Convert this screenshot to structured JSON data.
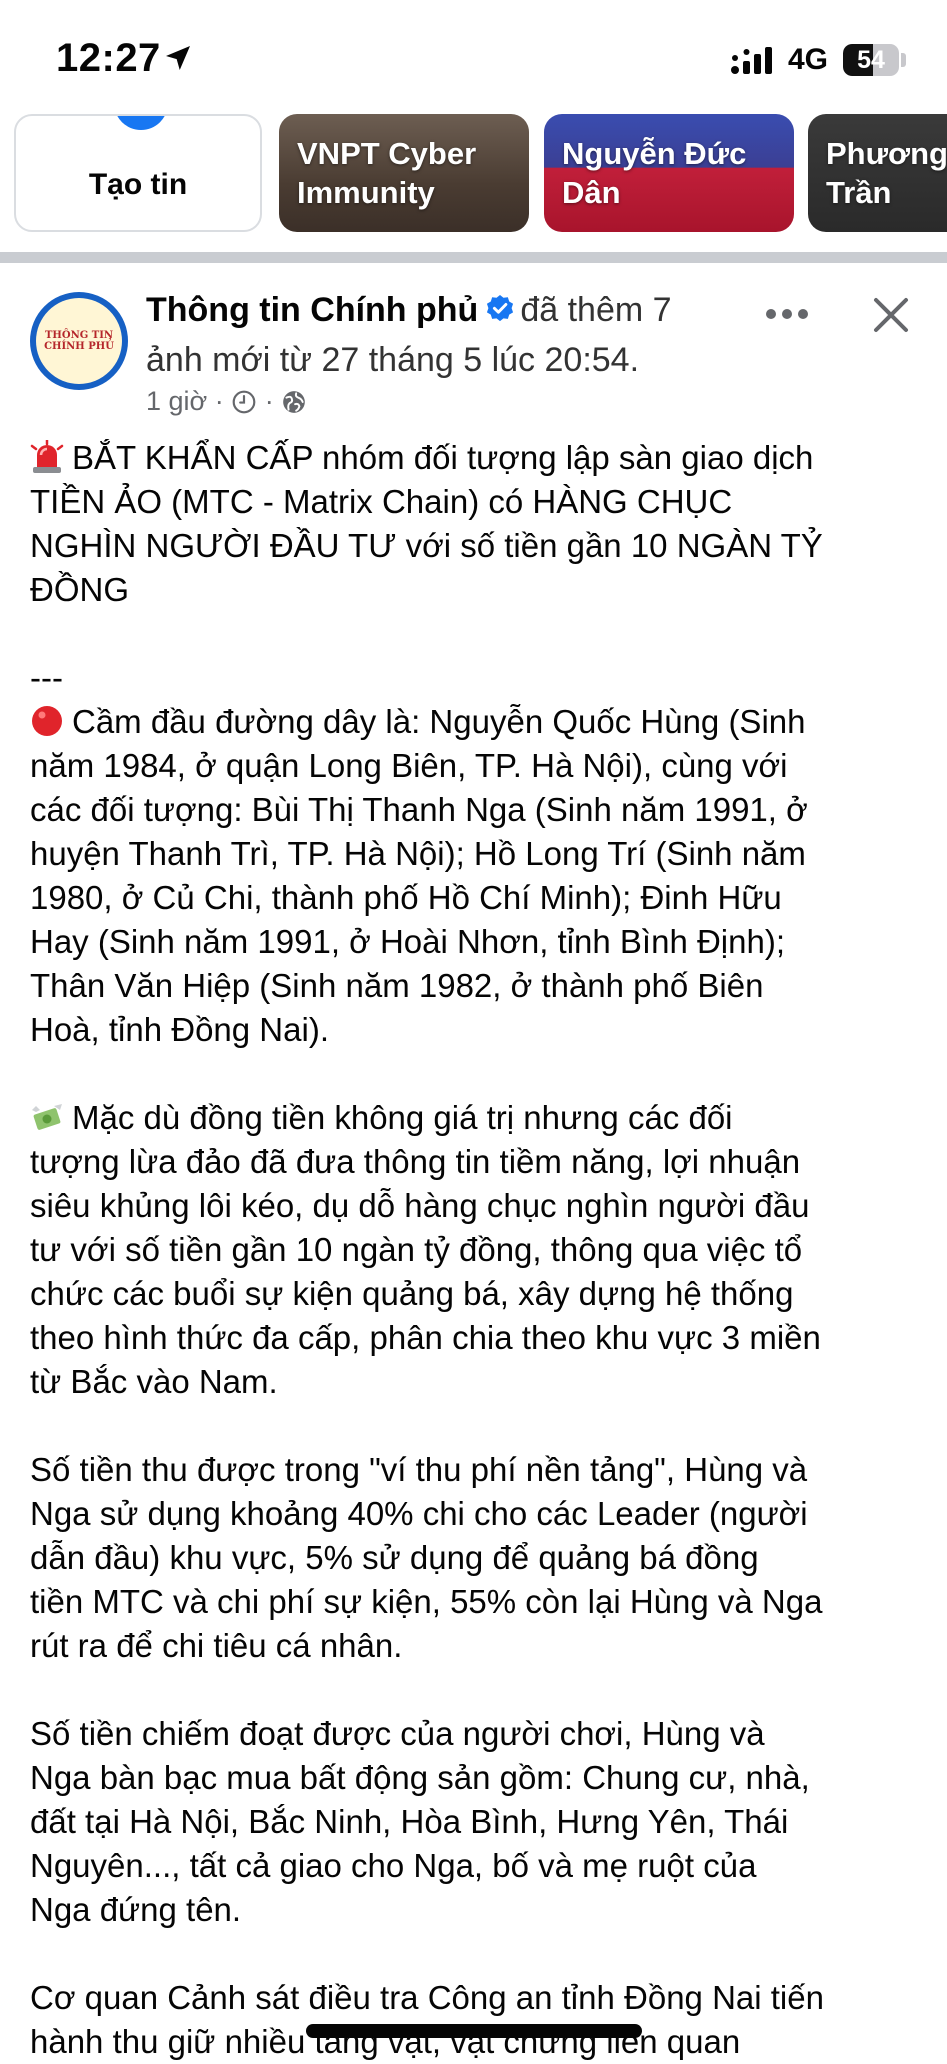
{
  "status_bar": {
    "time": "12:27",
    "network": "4G",
    "battery_level": "54",
    "battery_fraction": 0.54,
    "icons": [
      "location-arrow-icon",
      "signal-bars-icon",
      "battery-icon"
    ]
  },
  "stories": [
    {
      "label": "Tạo tin"
    },
    {
      "label": "VNPT Cyber Immunity"
    },
    {
      "label": "Nguyễn Đức Dân"
    },
    {
      "label": "Phương Trần"
    }
  ],
  "post": {
    "page_name": "Thông tin Chính phủ",
    "avatar_text_1": "THÔNG TIN",
    "avatar_text_2": "CHÍNH PHỦ",
    "action": "đã thêm 7",
    "action_cont": "ảnh mới từ 27 tháng 5 lúc 20:54.",
    "time_ago": "1 giờ",
    "dot": "·",
    "paragraphs": [
      {
        "emoji": "rotating-light-icon",
        "lines": [
          "BẮT KHẨN CẤP nhóm đối tượng lập sàn giao dịch",
          "TIỀN ẢO (MTC - Matrix Chain) có HÀNG CHỤC",
          "NGHÌN NGƯỜI ĐẦU TƯ với số tiền gần 10 NGÀN TỶ",
          "ĐỒNG"
        ]
      },
      {
        "separator": "---",
        "emoji": "red-circle-icon",
        "lines": [
          "Cầm đầu đường dây là: Nguyễn Quốc Hùng (Sinh",
          "năm 1984, ở quận Long Biên, TP. Hà Nội), cùng với",
          "các đối tượng:  Bùi Thị Thanh Nga (Sinh năm 1991, ở",
          "huyện Thanh Trì, TP. Hà Nội);  Hồ Long Trí (Sinh năm",
          "1980, ở Củ Chi, thành phố Hồ Chí Minh);  Đinh Hữu",
          "Hay (Sinh năm 1991, ở Hoài Nhơn, tỉnh Bình Định);",
          "Thân Văn Hiệp (Sinh năm 1982, ở thành phố Biên",
          "Hoà, tỉnh Đồng Nai)."
        ]
      },
      {
        "emoji": "money-wings-icon",
        "lines": [
          "Mặc dù đồng tiền không giá trị nhưng các đối",
          "tượng lừa đảo đã đưa thông tin tiềm năng, lợi nhuận",
          "siêu khủng lôi kéo, dụ dỗ hàng chục nghìn người đầu",
          "tư với số tiền gần 10 ngàn tỷ đồng, thông qua việc tổ",
          "chức các buổi sự kiện quảng bá, xây dựng hệ thống",
          "theo hình thức đa cấp, phân chia theo khu vực 3 miền",
          "từ Bắc vào Nam."
        ]
      },
      {
        "lines": [
          "Số tiền thu được trong \"ví thu phí nền tảng\", Hùng và",
          "Nga sử dụng khoảng 40% chi cho các Leader (người",
          "dẫn đầu) khu vực, 5% sử dụng để quảng bá đồng",
          "tiền MTC và chi phí sự kiện, 55% còn lại Hùng và Nga",
          "rút ra để chi tiêu cá nhân."
        ]
      },
      {
        "lines": [
          "Số tiền chiếm đoạt được của người chơi, Hùng và",
          "Nga bàn bạc mua bất động sản gồm: Chung cư, nhà,",
          "đất tại Hà Nội, Bắc Ninh, Hòa Bình, Hưng Yên, Thái",
          "Nguyên..., tất cả giao cho Nga, bố và mẹ ruột của",
          "Nga đứng tên."
        ]
      },
      {
        "lines": [
          "Cơ quan Cảnh sát điều tra Công an tỉnh Đồng Nai tiến",
          "hành thu giữ nhiều tang vật, vật chứng liên quan"
        ]
      }
    ]
  }
}
